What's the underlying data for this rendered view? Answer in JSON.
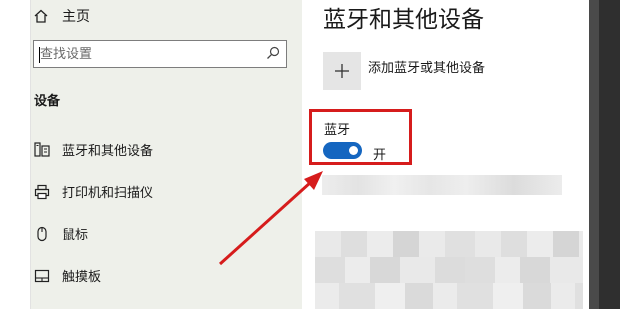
{
  "sidebar": {
    "home_label": "主页",
    "search_placeholder": "查找设置",
    "section_label": "设备",
    "items": [
      {
        "label": "蓝牙和其他设备",
        "icon": "devices-icon"
      },
      {
        "label": "打印机和扫描仪",
        "icon": "printer-icon"
      },
      {
        "label": "鼠标",
        "icon": "mouse-icon"
      },
      {
        "label": "触摸板",
        "icon": "touchpad-icon"
      }
    ]
  },
  "main": {
    "title": "蓝牙和其他设备",
    "add_device_label": "添加蓝牙或其他设备",
    "bluetooth_label": "蓝牙",
    "bluetooth_state": "开",
    "bluetooth_on": true
  },
  "colors": {
    "accent": "#1566c0",
    "annotation": "#d61c1c",
    "sidebar_bg": "#eef0ea"
  }
}
